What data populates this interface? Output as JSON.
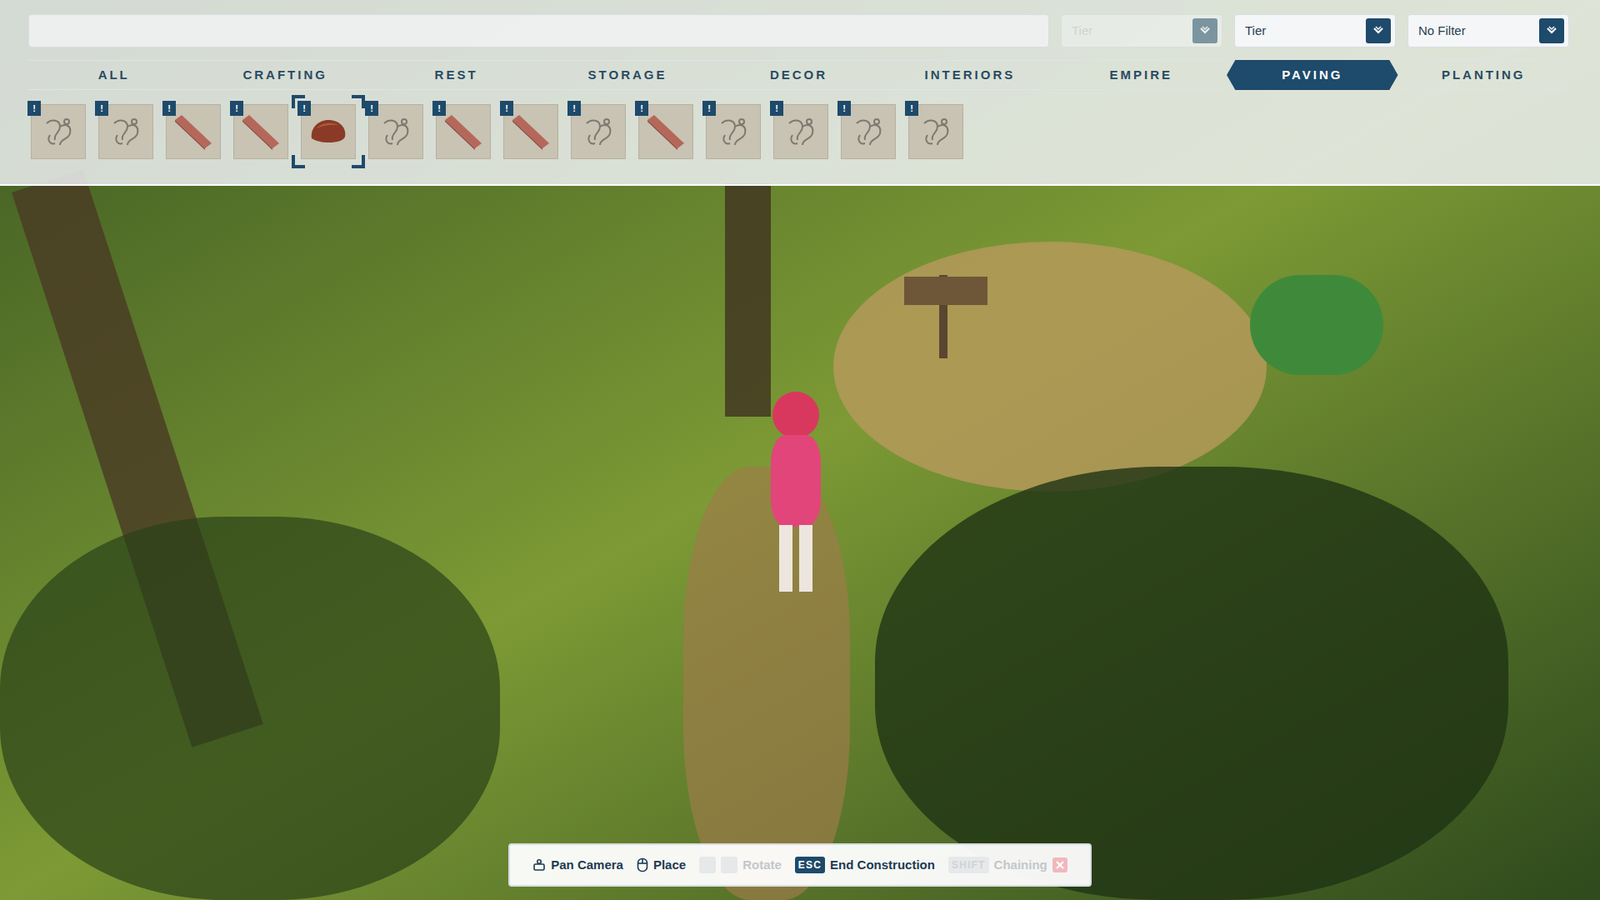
{
  "search": {
    "placeholder": ""
  },
  "filters": [
    {
      "label": "Tier",
      "disabled": true
    },
    {
      "label": "Tier",
      "disabled": false
    },
    {
      "label": "No Filter",
      "disabled": false
    }
  ],
  "tabs": [
    {
      "label": "ALL",
      "selected": false
    },
    {
      "label": "CRAFTING",
      "selected": false
    },
    {
      "label": "REST",
      "selected": false
    },
    {
      "label": "STORAGE",
      "selected": false
    },
    {
      "label": "DECOR",
      "selected": false
    },
    {
      "label": "INTERIORS",
      "selected": false
    },
    {
      "label": "EMPIRE",
      "selected": false
    },
    {
      "label": "PAVING",
      "selected": true
    },
    {
      "label": "PLANTING",
      "selected": false
    }
  ],
  "items": [
    {
      "kind": "locked",
      "badge": "!",
      "selected": false
    },
    {
      "kind": "locked",
      "badge": "!",
      "selected": false
    },
    {
      "kind": "plank",
      "badge": "!",
      "selected": false
    },
    {
      "kind": "plank",
      "badge": "!",
      "selected": false
    },
    {
      "kind": "rock",
      "badge": "!",
      "selected": true
    },
    {
      "kind": "locked",
      "badge": "!",
      "selected": false
    },
    {
      "kind": "plank",
      "badge": "!",
      "selected": false
    },
    {
      "kind": "plank",
      "badge": "!",
      "selected": false
    },
    {
      "kind": "locked",
      "badge": "!",
      "selected": false
    },
    {
      "kind": "plank",
      "badge": "!",
      "selected": false
    },
    {
      "kind": "locked",
      "badge": "!",
      "selected": false
    },
    {
      "kind": "locked",
      "badge": "!",
      "selected": false
    },
    {
      "kind": "locked",
      "badge": "!",
      "selected": false
    },
    {
      "kind": "locked",
      "badge": "!",
      "selected": false
    }
  ],
  "hints": [
    {
      "label": "Pan Camera",
      "kind": "pan",
      "keys": [],
      "disabled": false,
      "cancel": false
    },
    {
      "label": "Place",
      "kind": "mouse",
      "keys": [],
      "disabled": false,
      "cancel": false
    },
    {
      "label": "Rotate",
      "kind": "keys",
      "keys": [
        "",
        ""
      ],
      "disabled": true,
      "cancel": false
    },
    {
      "label": "End Construction",
      "kind": "keys",
      "keys": [
        "ESC"
      ],
      "disabled": false,
      "cancel": false
    },
    {
      "label": "Chaining",
      "kind": "keys",
      "keys": [
        "SHIFT"
      ],
      "disabled": true,
      "cancel": true
    }
  ]
}
